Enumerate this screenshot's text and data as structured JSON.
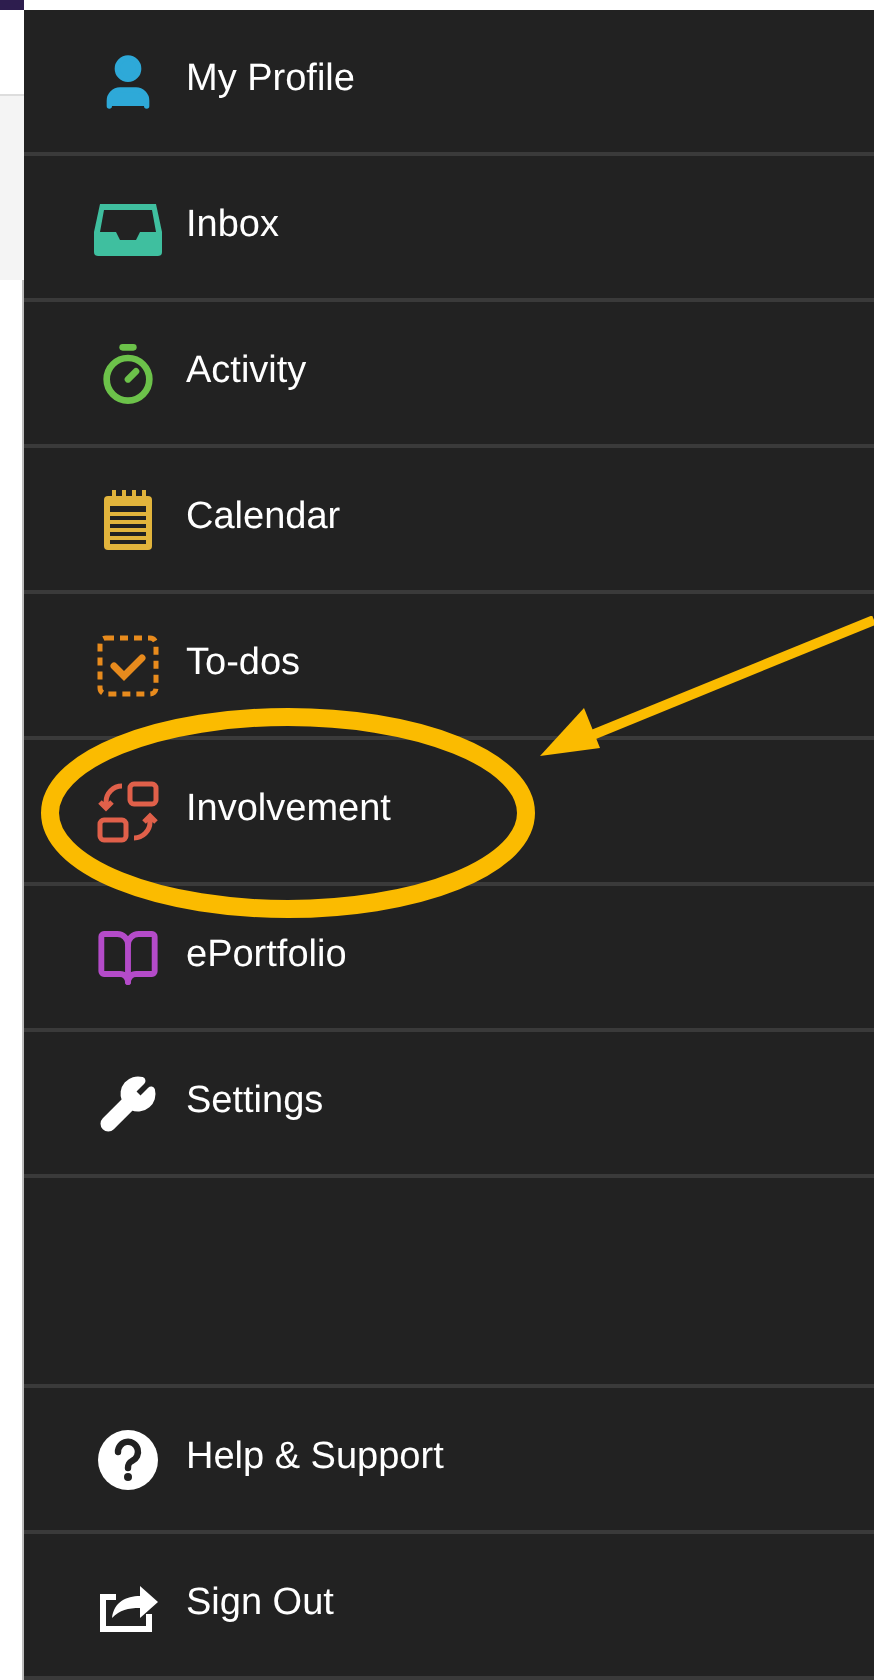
{
  "menu": {
    "items": [
      {
        "label": "My Profile",
        "circled": false
      },
      {
        "label": "Inbox",
        "circled": false
      },
      {
        "label": "Activity",
        "circled": false
      },
      {
        "label": "Calendar",
        "circled": false
      },
      {
        "label": "To-dos",
        "circled": false
      },
      {
        "label": "Involvement",
        "circled": true
      },
      {
        "label": "ePortfolio",
        "circled": false
      },
      {
        "label": "Settings",
        "circled": false
      }
    ]
  },
  "footer_items": [
    {
      "label": "Help & Support"
    },
    {
      "label": "Sign Out"
    }
  ]
}
